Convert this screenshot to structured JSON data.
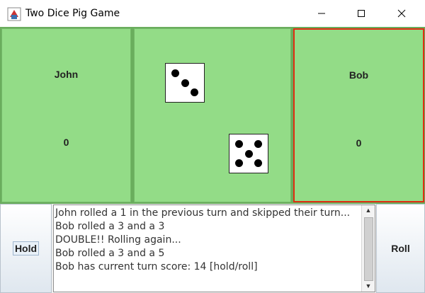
{
  "window": {
    "title": "Two Dice Pig Game"
  },
  "players": [
    {
      "name": "John",
      "score": "0",
      "active": false
    },
    {
      "name": "Bob",
      "score": "0",
      "active": true
    }
  ],
  "dice": [
    3,
    5
  ],
  "buttons": {
    "hold": "Hold",
    "roll": "Roll"
  },
  "log": [
    "John rolled a 1 in the previous turn and skipped their turn...",
    "Bob rolled a 3 and a 3",
    "DOUBLE!! Rolling again...",
    "Bob rolled a 3 and a 5",
    "Bob has current turn score: 14 [hold/roll]"
  ],
  "colors": {
    "panel": "#93dc87",
    "active_border": "#e02d12",
    "board_bg": "#6aad5d"
  }
}
